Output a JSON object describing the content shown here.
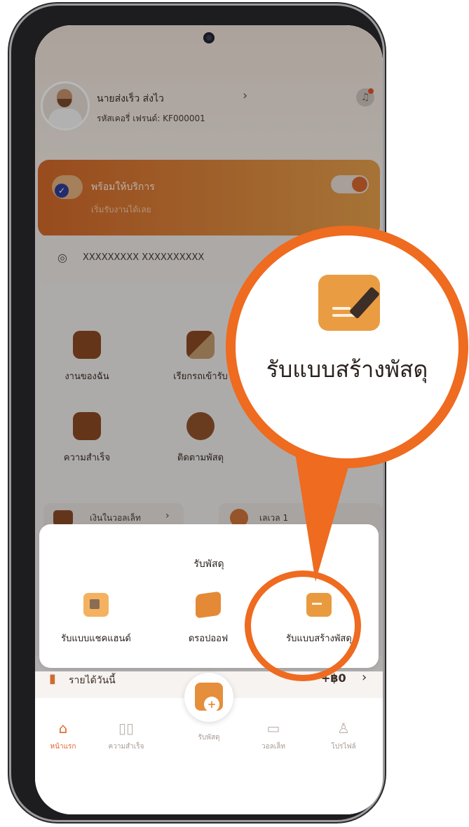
{
  "user": {
    "name": "นายส่งเร็ว ส่งไว",
    "code": "รหัสเคอรี่ เฟรนด์: KF000001"
  },
  "service_card": {
    "title": "พร้อมให้บริการ",
    "subtitle": "เริ่มรับงานได้เลย"
  },
  "address": "XXXXXXXXX XXXXXXXXXX",
  "menu": [
    {
      "label": "งานของฉัน"
    },
    {
      "label": "เรียกรถเข้ารับ"
    },
    {
      "label": "ความสำเร็จ"
    },
    {
      "label": "ติดตามพัสดุ"
    }
  ],
  "wallet": {
    "label": "เงินในวอลเล็ท"
  },
  "level": {
    "label": "เลเวล 1"
  },
  "income": {
    "label": "รายได้วันนี้",
    "value": "+฿0"
  },
  "sheet": {
    "title": "รับพัสดุ",
    "options": [
      {
        "label": "รับแบบแชคแฮนด์",
        "icon": "handout-icon"
      },
      {
        "label": "ดรอปออฟ",
        "icon": "dropoff-icon"
      },
      {
        "label": "รับแบบสร้างพัสดุ",
        "icon": "create-parcel-icon"
      }
    ]
  },
  "zoom": {
    "label": "รับแบบสร้างพัสดุ"
  },
  "nav": [
    {
      "label": "หน้าแรก",
      "active": true
    },
    {
      "label": "ความสำเร็จ"
    },
    {
      "label": "รับพัสดุ"
    },
    {
      "label": "วอลเล็ท"
    },
    {
      "label": "โปรไฟล์"
    }
  ],
  "colors": {
    "accent": "#ee6b20",
    "brand_orange": "#e58e3b"
  }
}
